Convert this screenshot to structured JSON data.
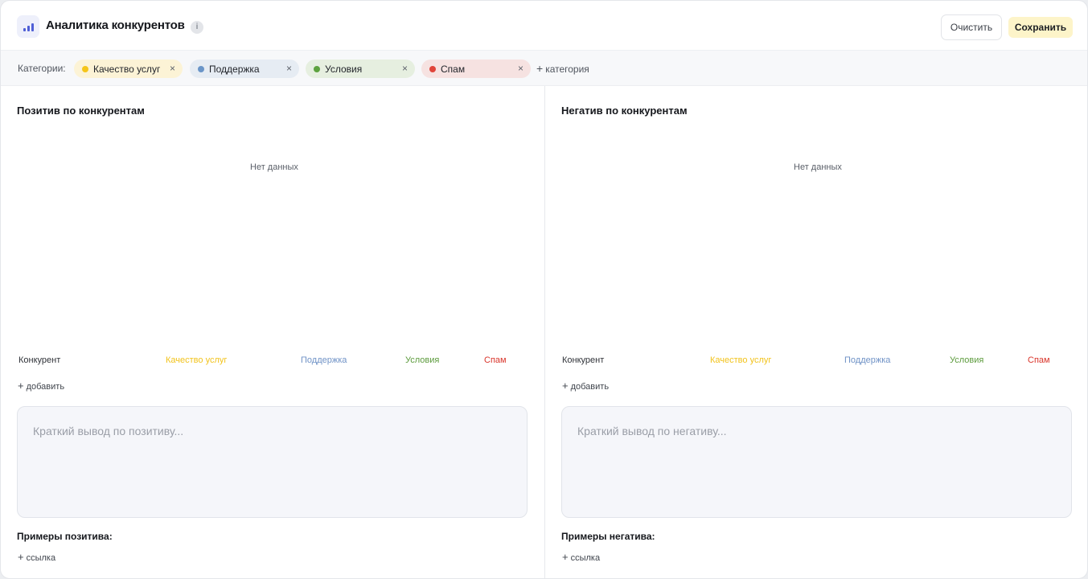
{
  "header": {
    "title": "Аналитика конкурентов",
    "info_icon": "i",
    "clear_label": "Очистить",
    "save_label": "Сохранить"
  },
  "categories_bar": {
    "label": "Категории:",
    "chips": [
      {
        "label": "Качество услуг",
        "dot_color": "#f5c518",
        "bg": "#fcf3d6"
      },
      {
        "label": "Поддержка",
        "dot_color": "#6a95c8",
        "bg": "#e6ecf3"
      },
      {
        "label": "Условия",
        "dot_color": "#5da23f",
        "bg": "#e6efe0"
      },
      {
        "label": "Спам",
        "dot_color": "#e0443a",
        "bg": "#f6e2e1"
      }
    ],
    "close_glyph": "×",
    "add_label": "категория",
    "add_glyph": "+"
  },
  "panels": {
    "positive": {
      "title": "Позитив по конкурентам",
      "empty_text": "Нет данных",
      "legend": [
        "Конкурент",
        "Качество услуг",
        "Поддержка",
        "Условия",
        "Спам"
      ],
      "add_label": "добавить",
      "summary_placeholder": "Краткий вывод по позитиву...",
      "examples_title": "Примеры позитива:",
      "add_link_label": "ссылка"
    },
    "negative": {
      "title": "Негатив по конкурентам",
      "empty_text": "Нет данных",
      "legend": [
        "Конкурент",
        "Качество услуг",
        "Поддержка",
        "Условия",
        "Спам"
      ],
      "add_label": "добавить",
      "summary_placeholder": "Краткий вывод по негативу...",
      "examples_title": "Примеры негатива:",
      "add_link_label": "ссылка"
    }
  },
  "colors": {
    "competitor": "#2f3238",
    "quality": "#f2c31c",
    "support": "#6f92c6",
    "conditions": "#5c9b3c",
    "spam": "#d9352b"
  },
  "add_glyph": "+"
}
